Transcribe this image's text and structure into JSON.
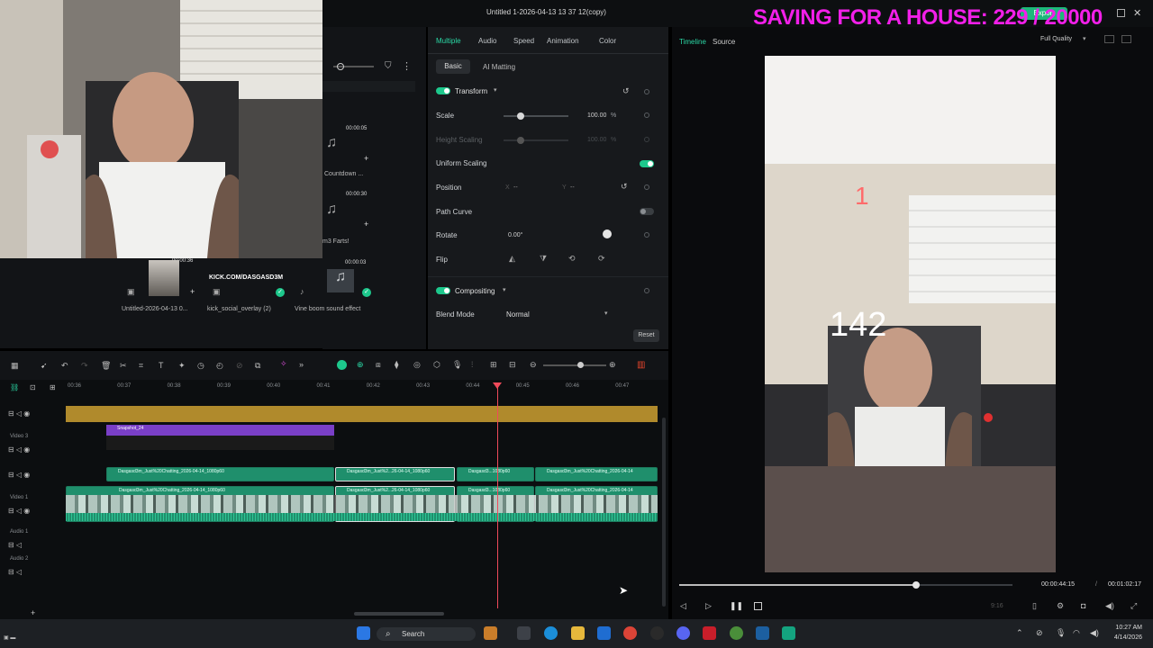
{
  "window": {
    "title": "Untitled 1-2026-04-13 13 37 12(copy)",
    "export_label": "Export"
  },
  "overlay": {
    "saving_text": "SAVING FOR A HOUSE: 229 / 20000"
  },
  "media": {
    "items": [
      {
        "duration": "00:00:05",
        "name": "Countdown ..."
      },
      {
        "duration": "00:00:30",
        "name": "m3 Farts!"
      },
      {
        "duration": "00:00:36",
        "name": "Untitled-2026-04-13 0..."
      },
      {
        "duration": "",
        "name": "kick_social_overlay (2)",
        "overlay_text": "KICK.COM/DASGASD3M"
      },
      {
        "duration": "00:00:03",
        "name": "Vine boom sound effect"
      }
    ]
  },
  "properties": {
    "tabs": [
      "Multiple",
      "Audio",
      "Speed",
      "Animation",
      "Color"
    ],
    "active_tab": "Multiple",
    "subtabs": [
      "Basic",
      "AI Matting"
    ],
    "transform_label": "Transform",
    "scale_label": "Scale",
    "scale_value": "100.00",
    "scale_unit": "%",
    "height_label": "Height Scaling",
    "height_value": "100.00",
    "height_unit": "%",
    "uniform_label": "Uniform Scaling",
    "position_label": "Position",
    "pos_x_label": "X",
    "pos_x_value": "--",
    "pos_y_label": "Y",
    "pos_y_value": "--",
    "path_curve_label": "Path Curve",
    "rotate_label": "Rotate",
    "rotate_value": "0.00°",
    "flip_label": "Flip",
    "compositing_label": "Compositing",
    "blend_label": "Blend Mode",
    "blend_value": "Normal",
    "reset_label": "Reset"
  },
  "player": {
    "tabs": [
      "Timeline",
      "Source"
    ],
    "quality": "Full Quality",
    "current_time": "00:00:44:15",
    "separator": "/",
    "total_time": "00:01:02:17",
    "ratio": "9:16",
    "overlay_number": "142",
    "overlay_small": "1",
    "progress_fraction": 0.71
  },
  "timeline": {
    "ruler": [
      "00:36",
      "00:37",
      "00:38",
      "00:39",
      "00:40",
      "00:41",
      "00:42",
      "00:43",
      "00:44",
      "00:45",
      "00:46",
      "00:47"
    ],
    "tracks": [
      "Video 3",
      "Video 1",
      "Audio 1",
      "Audio 2"
    ],
    "snapshot_clip": "Snapshot_24",
    "clips_row1": [
      "Dasgasd3m_Just%20Chatting_2026-04-14_1080p60",
      "Dasgasd3m_Just%2...26-04-14_1080p60",
      "Dasgasd3...1080p60",
      "Dasgasd3m_Just%20Chatting_2026-04-14"
    ],
    "clips_row2": [
      "Dasgasd3m_Just%20Chatting_2026-04-14_1080p60",
      "Dasgasd3m_Just%2...26-04-14_1080p60",
      "Dasgasd3...1080p60",
      "Dasgasd3m_Just%20Chatting_2026-04-14"
    ]
  },
  "taskbar": {
    "search_label": "Search",
    "time": "10:27 AM",
    "date": "4/14/2026"
  },
  "colors": {
    "accent": "#2bd9a6",
    "overlay_pink": "#f21fe9",
    "playhead": "#f04a5a",
    "clip_green": "#1f8f6c",
    "clip_purple": "#7a3fc7"
  }
}
